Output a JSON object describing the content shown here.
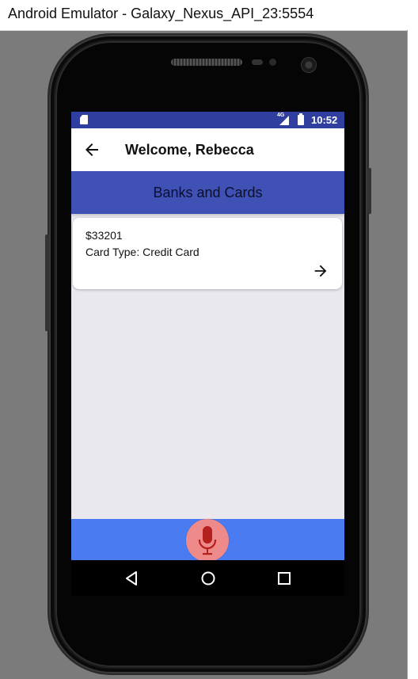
{
  "window": {
    "title": "Android Emulator - Galaxy_Nexus_API_23:5554"
  },
  "statusbar": {
    "network": "4G",
    "time": "10:52",
    "icons": [
      "sd-card-icon",
      "signal-icon",
      "battery-icon"
    ]
  },
  "appbar": {
    "back_icon": "arrow-left-icon",
    "title": "Welcome, Rebecca"
  },
  "section": {
    "title": "Banks and Cards"
  },
  "cards": [
    {
      "amount": "$33201",
      "card_type": "Card Type: Credit Card",
      "action_icon": "arrow-right-icon"
    }
  ],
  "bottom": {
    "mic_icon": "microphone-icon"
  },
  "navbar": {
    "icons": [
      "nav-back-icon",
      "nav-home-icon",
      "nav-recents-icon"
    ]
  },
  "colors": {
    "statusbar": "#303f9f",
    "header": "#3f51b5",
    "bottombar": "#4a7bf0",
    "mic": "#ef8a8a",
    "mic_icon": "#b3201e",
    "screen_bg": "#e9e8ee"
  }
}
